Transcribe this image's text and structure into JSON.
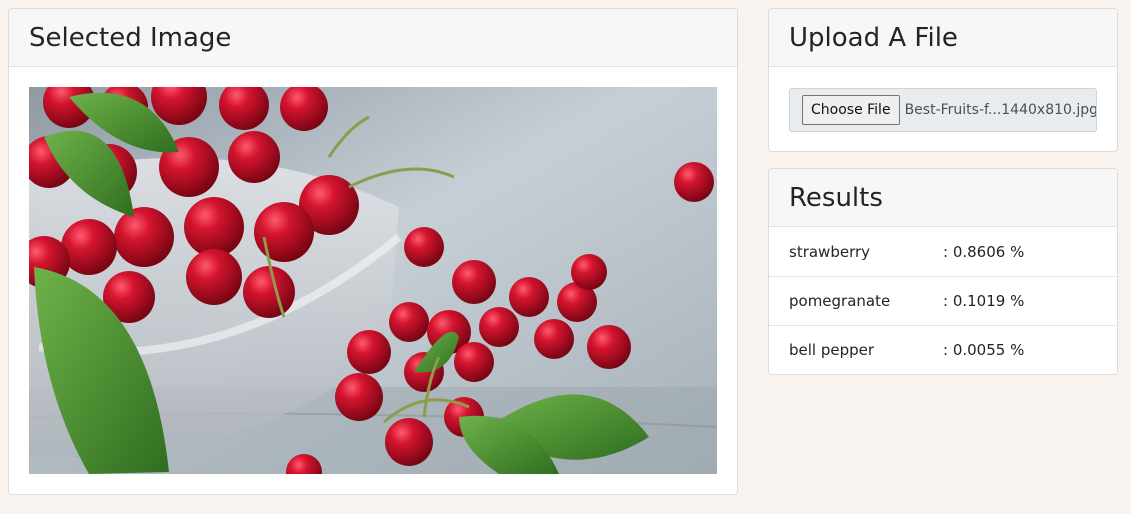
{
  "selected_panel": {
    "title": "Selected Image",
    "image_subject": "bowl of red cherries with green leaves"
  },
  "upload_panel": {
    "title": "Upload A File",
    "choose_button_label": "Choose File",
    "file_name": "Best-Fruits-f...1440x810.jpg"
  },
  "results_panel": {
    "title": "Results",
    "rows": [
      {
        "label": "strawberry",
        "value": ": 0.8606 %"
      },
      {
        "label": "pomegranate",
        "value": ": 0.1019 %"
      },
      {
        "label": "bell pepper",
        "value": ": 0.0055 %"
      }
    ]
  },
  "colors": {
    "page_background": "#f8f3ee",
    "card_header": "#f7f7f7",
    "cherry_red": "#c8102e",
    "leaf_green": "#3f8a2c"
  }
}
